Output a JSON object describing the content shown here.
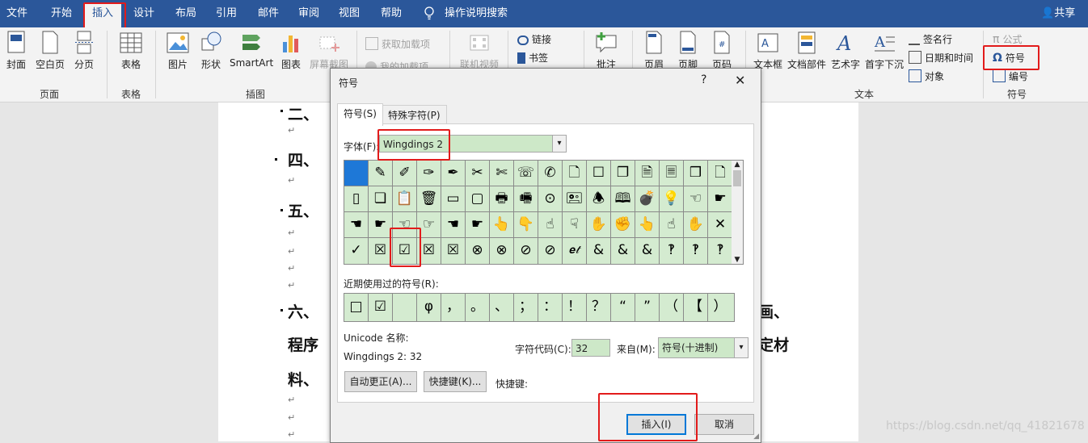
{
  "tabs": [
    "文件",
    "开始",
    "插入",
    "设计",
    "布局",
    "引用",
    "邮件",
    "审阅",
    "视图",
    "帮助"
  ],
  "tell_me": "操作说明搜索",
  "share": "共享",
  "ribbon": {
    "page": {
      "cover": "封面",
      "blank": "空白页",
      "break": "分页",
      "group": "页面"
    },
    "table": {
      "table": "表格",
      "group": "表格"
    },
    "illus": {
      "picture": "图片",
      "shapes": "形状",
      "smartart": "SmartArt",
      "chart": "图表",
      "screenshot": "屏幕截图",
      "group": "插图"
    },
    "addins": {
      "get": "获取加载项",
      "mine": "我的加载项"
    },
    "media": {
      "online_video": "联机视频"
    },
    "links": {
      "link": "链接",
      "bookmark": "书签"
    },
    "comments": {
      "comment": "批注"
    },
    "headerfooter": {
      "header": "页眉",
      "footer": "页脚",
      "page_number": "页码"
    },
    "text": {
      "textbox": "文本框",
      "parts": "文档部件",
      "wordart": "艺术字",
      "dropcap": "首字下沉",
      "signature": "签名行",
      "datetime": "日期和时间",
      "object": "对象",
      "group": "文本"
    },
    "symbols": {
      "equation": "公式",
      "symbol": "符号",
      "number": "编号",
      "group": "符号"
    }
  },
  "document": {
    "lines": [
      "二、",
      "四、",
      "五、",
      "六、",
      "程序",
      "料、"
    ],
    "right_fragments": [
      "画、",
      "定材"
    ],
    "para_mark": "↵"
  },
  "dialog": {
    "title": "符号",
    "help": "?",
    "close": "✕",
    "tab_symbols": "符号(S)",
    "tab_special": "特殊字符(P)",
    "font_label": "字体(F):",
    "font_value": "Wingdings 2",
    "symbols": [
      "",
      "✎",
      "✐",
      "✑",
      "✒",
      "✂",
      "✄",
      "☏",
      "✆",
      "🗋",
      "☐",
      "❐",
      "🗎",
      "🗏",
      "❒",
      "🗋",
      "▯",
      "❏",
      "📋",
      "🗑",
      "▭",
      "▢",
      "🖶",
      "🖷",
      "⊙",
      "🖭",
      "🕭",
      "🕮",
      "💣",
      "💡",
      "☜",
      "☛",
      "☚",
      "☛",
      "☜",
      "☞",
      "☚",
      "☛",
      "👆",
      "👇",
      "☝",
      "☟",
      "✋",
      "✊",
      "👆",
      "☝",
      "✋",
      "✕",
      "✓",
      "☒",
      "☑",
      "☒",
      "☒",
      "⊗",
      "⊗",
      "⊘",
      "⊘",
      "𝒆𝓉",
      "&",
      "&",
      "&",
      "‽",
      "‽",
      "‽"
    ],
    "recent_label": "近期使用过的符号(R):",
    "recent": [
      "□",
      "☑",
      "",
      "φ",
      "，",
      "。",
      "、",
      "；",
      "：",
      "！",
      "？",
      "“",
      "”",
      "（",
      "【",
      "）"
    ],
    "unicode_label": "Unicode 名称:",
    "unicode_value": "Wingdings 2: 32",
    "charcode_label": "字符代码(C):",
    "charcode_value": "32",
    "from_label": "来自(M):",
    "from_value": "符号(十进制)",
    "autocorrect": "自动更正(A)...",
    "shortcut_btn": "快捷键(K)...",
    "shortcut_label": "快捷键:",
    "insert": "插入(I)",
    "cancel": "取消"
  },
  "watermark": "https://blog.csdn.net/qq_41821678"
}
